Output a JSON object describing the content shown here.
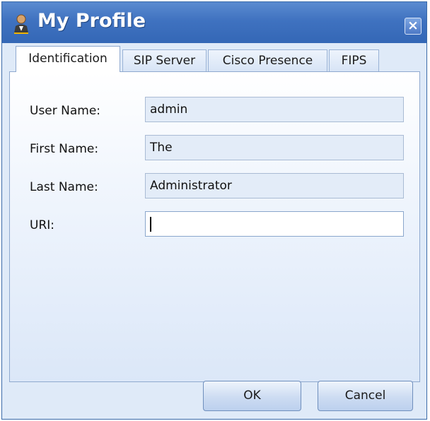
{
  "window": {
    "title": "My Profile",
    "title_icon": "user-icon",
    "close_glyph": "×"
  },
  "tabs": [
    {
      "label": "Identification",
      "active": true
    },
    {
      "label": "SIP Server",
      "active": false
    },
    {
      "label": "Cisco Presence",
      "active": false
    },
    {
      "label": "FIPS",
      "active": false
    }
  ],
  "form": {
    "fields": [
      {
        "label": "User Name:",
        "value": "admin",
        "editable": false
      },
      {
        "label": "First Name:",
        "value": "The",
        "editable": false
      },
      {
        "label": "Last Name:",
        "value": "Administrator",
        "editable": false
      },
      {
        "label": "URI:",
        "value": "",
        "editable": true
      }
    ]
  },
  "buttons": {
    "ok_label": "OK",
    "cancel_label": "Cancel"
  },
  "colors": {
    "titlebar": "#3f72c0",
    "panel_bg": "#dfeaf8",
    "readonly_field": "#e3ecf8"
  }
}
